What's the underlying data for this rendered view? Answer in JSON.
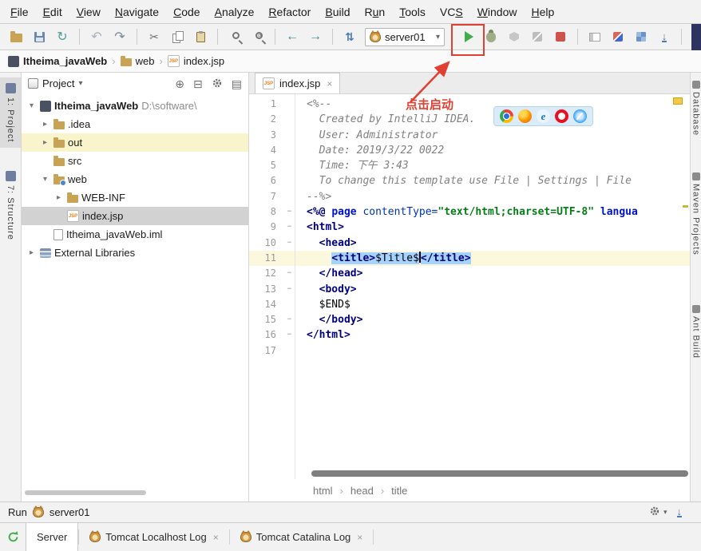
{
  "icons": {
    "close": "×",
    "chevron_down": "▾",
    "chevron_right": "▸",
    "crumb_sep": "›",
    "fold": "−",
    "locate": "⊕",
    "collapse": "⊟",
    "menu": "▤",
    "sync": "↻",
    "undo": "↶",
    "redo": "↷",
    "back": "←",
    "forward": "→",
    "updown": "⇅",
    "down": "↓",
    "help": "?",
    "cut": "✂"
  },
  "menu": {
    "items": [
      {
        "label": "File",
        "m": 0
      },
      {
        "label": "Edit",
        "m": 0
      },
      {
        "label": "View",
        "m": 0
      },
      {
        "label": "Navigate",
        "m": 0
      },
      {
        "label": "Code",
        "m": 0
      },
      {
        "label": "Analyze",
        "m": 0
      },
      {
        "label": "Refactor",
        "m": 0
      },
      {
        "label": "Build",
        "m": 0
      },
      {
        "label": "Run",
        "m": 1
      },
      {
        "label": "Tools",
        "m": 0
      },
      {
        "label": "VCS",
        "m": 2
      },
      {
        "label": "Window",
        "m": 0
      },
      {
        "label": "Help",
        "m": 0
      }
    ]
  },
  "toolbar": {
    "run_config": "server01"
  },
  "breadcrumb": {
    "items": [
      {
        "label": "Itheima_javaWeb",
        "icon": "project",
        "bold": true
      },
      {
        "label": "web",
        "icon": "folder",
        "bold": false
      },
      {
        "label": "index.jsp",
        "icon": "jsp",
        "bold": false
      }
    ]
  },
  "left_stripe": {
    "items": [
      {
        "label": "1: Project",
        "active": true
      },
      {
        "label": "7: Structure",
        "active": false
      }
    ]
  },
  "right_stripe": {
    "items": [
      "Database",
      "Maven Projects",
      "Ant Build"
    ]
  },
  "project": {
    "header": "Project",
    "tree": [
      {
        "label": "Itheima_javaWeb",
        "suffix": "D:\\software\\",
        "indent": 0,
        "chevron": "v",
        "icon": "project",
        "bold": true,
        "bg": ""
      },
      {
        "label": ".idea",
        "indent": 1,
        "chevron": ">",
        "icon": "folder",
        "bold": false,
        "bg": ""
      },
      {
        "label": "out",
        "indent": 1,
        "chevron": ">",
        "icon": "folder",
        "bold": false,
        "bg": "hover"
      },
      {
        "label": "src",
        "indent": 1,
        "chevron": "",
        "icon": "folder",
        "bold": false,
        "bg": ""
      },
      {
        "label": "web",
        "indent": 1,
        "chevron": "v",
        "icon": "web",
        "bold": false,
        "bg": ""
      },
      {
        "label": "WEB-INF",
        "indent": 2,
        "chevron": ">",
        "icon": "folder",
        "bold": false,
        "bg": ""
      },
      {
        "label": "index.jsp",
        "indent": 2,
        "chevron": "",
        "icon": "jsp",
        "bold": false,
        "bg": "selected"
      },
      {
        "label": "Itheima_javaWeb.iml",
        "indent": 1,
        "chevron": "",
        "icon": "file",
        "bold": false,
        "bg": ""
      },
      {
        "label": "External Libraries",
        "indent": 0,
        "chevron": ">",
        "icon": "lib",
        "bold": false,
        "bg": ""
      }
    ]
  },
  "editor": {
    "tab": "index.jsp",
    "breadcrumb": [
      "html",
      "head",
      "title"
    ],
    "annotation": "点击启动",
    "browser_icons": [
      "chrome",
      "firefox",
      "ie",
      "opera",
      "safari"
    ],
    "lines": [
      {
        "n": 1,
        "fold": false,
        "segs": [
          {
            "t": "<%--",
            "c": "cm"
          }
        ]
      },
      {
        "n": 2,
        "fold": false,
        "segs": [
          {
            "t": "  Created by IntelliJ IDEA.",
            "c": "cm"
          }
        ]
      },
      {
        "n": 3,
        "fold": false,
        "segs": [
          {
            "t": "  User: Administrator",
            "c": "cm"
          }
        ]
      },
      {
        "n": 4,
        "fold": false,
        "segs": [
          {
            "t": "  Date: 2019/3/22 0022",
            "c": "cm"
          }
        ]
      },
      {
        "n": 5,
        "fold": false,
        "segs": [
          {
            "t": "  Time: 下午 3:43",
            "c": "cm"
          }
        ]
      },
      {
        "n": 6,
        "fold": false,
        "segs": [
          {
            "t": "  To change this template use File | Settings | File",
            "c": "cm"
          }
        ]
      },
      {
        "n": 7,
        "fold": false,
        "segs": [
          {
            "t": "--%>",
            "c": "cm"
          }
        ]
      },
      {
        "n": 8,
        "fold": true,
        "segs": [
          {
            "t": "<%@ ",
            "c": "tag"
          },
          {
            "t": "page ",
            "c": "kw"
          },
          {
            "t": "contentType=",
            "c": "attr"
          },
          {
            "t": "\"text/html;charset=UTF-8\"",
            "c": "str"
          },
          {
            "t": " ",
            "c": "pl"
          },
          {
            "t": "langua",
            "c": "kw"
          }
        ]
      },
      {
        "n": 9,
        "fold": true,
        "segs": [
          {
            "t": "<html>",
            "c": "tag"
          }
        ]
      },
      {
        "n": 10,
        "fold": true,
        "segs": [
          {
            "t": "  ",
            "c": "pl"
          },
          {
            "t": "<head>",
            "c": "tag"
          }
        ]
      },
      {
        "n": 11,
        "fold": false,
        "caret": true,
        "segs": [
          {
            "t": "    ",
            "c": "pl"
          },
          {
            "t": "<title>",
            "c": "tag",
            "sel": true
          },
          {
            "t": "$Title$",
            "c": "pl",
            "sel": true,
            "caretAfter": true
          },
          {
            "t": "</title>",
            "c": "tag",
            "sel": true
          }
        ]
      },
      {
        "n": 12,
        "fold": true,
        "segs": [
          {
            "t": "  ",
            "c": "pl"
          },
          {
            "t": "</head>",
            "c": "tag"
          }
        ]
      },
      {
        "n": 13,
        "fold": true,
        "segs": [
          {
            "t": "  ",
            "c": "pl"
          },
          {
            "t": "<body>",
            "c": "tag"
          }
        ]
      },
      {
        "n": 14,
        "fold": false,
        "segs": [
          {
            "t": "  $END$",
            "c": "pl"
          }
        ]
      },
      {
        "n": 15,
        "fold": true,
        "segs": [
          {
            "t": "  ",
            "c": "pl"
          },
          {
            "t": "</body>",
            "c": "tag"
          }
        ]
      },
      {
        "n": 16,
        "fold": true,
        "segs": [
          {
            "t": "</html>",
            "c": "tag"
          }
        ]
      },
      {
        "n": 17,
        "fold": false,
        "segs": []
      }
    ]
  },
  "run_bar": {
    "label": "Run",
    "config": "server01"
  },
  "bottom_tabs": {
    "tabs": [
      {
        "label": "Server",
        "active": true,
        "closable": false,
        "icon": false
      },
      {
        "label": "Tomcat Localhost Log",
        "active": false,
        "closable": true,
        "icon": true
      },
      {
        "label": "Tomcat Catalina Log",
        "active": false,
        "closable": true,
        "icon": true
      }
    ]
  }
}
